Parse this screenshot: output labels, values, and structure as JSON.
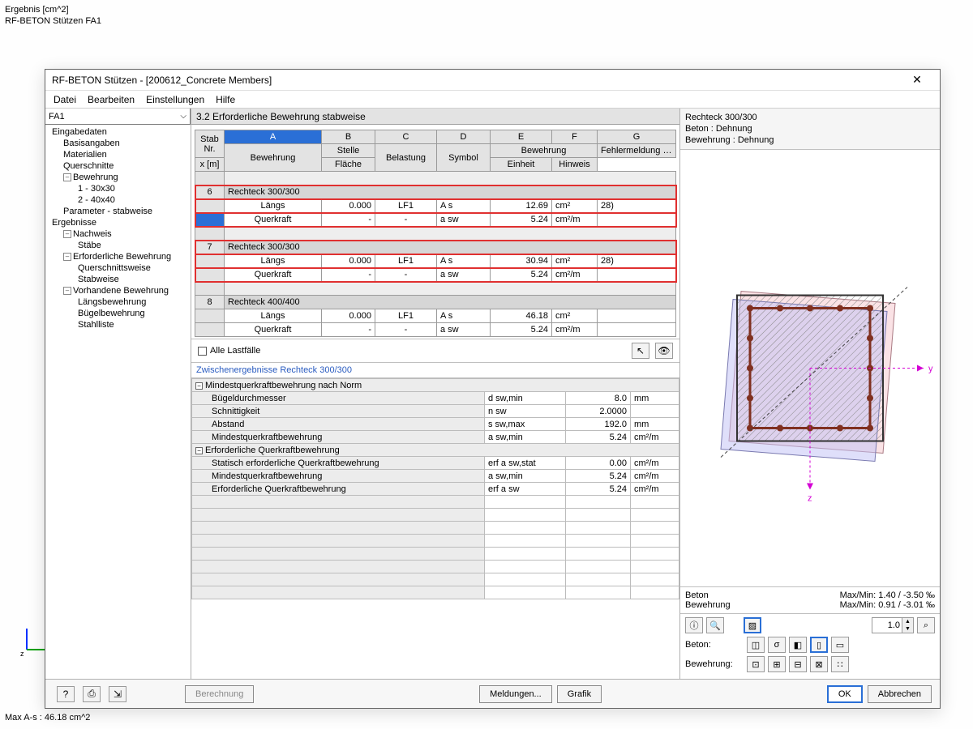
{
  "bg": {
    "l1": "Ergebnis  [cm^2]",
    "l2": "RF-BETON Stützen FA1",
    "bottom": "Max A-s : 46.18 cm^2"
  },
  "window": {
    "title": "RF-BETON Stützen - [200612_Concrete Members]"
  },
  "menu": {
    "datei": "Datei",
    "bearbeiten": "Bearbeiten",
    "einstellungen": "Einstellungen",
    "hilfe": "Hilfe"
  },
  "combo": {
    "value": "FA1"
  },
  "tree": {
    "eingabedaten": "Eingabedaten",
    "basisangaben": "Basisangaben",
    "materialien": "Materialien",
    "querschnitte": "Querschnitte",
    "bewehrung": "Bewehrung",
    "b1": "1 - 30x30",
    "b2": "2 - 40x40",
    "parameter": "Parameter - stabweise",
    "ergebnisse": "Ergebnisse",
    "nachweis": "Nachweis",
    "staebe": "Stäbe",
    "erf": "Erforderliche Bewehrung",
    "querschnittsweise": "Querschnittsweise",
    "stabweise": "Stabweise",
    "vorh": "Vorhandene Bewehrung",
    "laengs": "Längsbewehrung",
    "buegel": "Bügelbewehrung",
    "stahl": "Stahlliste"
  },
  "section": "3.2 Erforderliche Bewehrung stabweise",
  "cols": {
    "letters": {
      "A": "A",
      "B": "B",
      "C": "C",
      "D": "D",
      "E": "E",
      "F": "F",
      "G": "G"
    },
    "stab": "Stab",
    "nr": "Nr.",
    "bewehrung": "Bewehrung",
    "stelle": "Stelle",
    "x": "x [m]",
    "belastung": "Belastung",
    "symbol": "Symbol",
    "bew2": "Bewehrung",
    "flaeche": "Fläche",
    "einheit": "Einheit",
    "fehler": "Fehlermeldung bzw.",
    "hinweis": "Hinweis"
  },
  "groups": [
    {
      "nr": "6",
      "title": "Rechteck 300/300",
      "hl": true,
      "rows": [
        {
          "bew": "Längs",
          "x": "0.000",
          "bel": "LF1",
          "sym": "A s",
          "fla": "12.69",
          "ein": "cm²",
          "hin": "28)"
        },
        {
          "bew": "Querkraft",
          "x": "-",
          "bel": "-",
          "sym": "a sw",
          "fla": "5.24",
          "ein": "cm²/m",
          "hin": "",
          "sel": true
        }
      ]
    },
    {
      "nr": "7",
      "title": "Rechteck 300/300",
      "hl": true,
      "rows": [
        {
          "bew": "Längs",
          "x": "0.000",
          "bel": "LF1",
          "sym": "A s",
          "fla": "30.94",
          "ein": "cm²",
          "hin": "28)"
        },
        {
          "bew": "Querkraft",
          "x": "-",
          "bel": "-",
          "sym": "a sw",
          "fla": "5.24",
          "ein": "cm²/m",
          "hin": ""
        }
      ]
    },
    {
      "nr": "8",
      "title": "Rechteck 400/400",
      "hl": false,
      "rows": [
        {
          "bew": "Längs",
          "x": "0.000",
          "bel": "LF1",
          "sym": "A s",
          "fla": "46.18",
          "ein": "cm²",
          "hin": ""
        },
        {
          "bew": "Querkraft",
          "x": "-",
          "bel": "-",
          "sym": "a sw",
          "fla": "5.24",
          "ein": "cm²/m",
          "hin": ""
        }
      ]
    }
  ],
  "all_lf": "Alle Lastfälle",
  "zres_title": "Zwischenergebnisse Rechteck 300/300",
  "props": [
    {
      "type": "g",
      "label": "Mindestquerkraftbewehrung nach Norm",
      "open": false
    },
    {
      "type": "r",
      "label": "Bügeldurchmesser",
      "sym": "d sw,min",
      "val": "8.0",
      "unit": "mm"
    },
    {
      "type": "r",
      "label": "Schnittigkeit",
      "sym": "n sw",
      "val": "2.0000",
      "unit": ""
    },
    {
      "type": "r",
      "label": "Abstand",
      "sym": "s sw,max",
      "val": "192.0",
      "unit": "mm"
    },
    {
      "type": "r",
      "label": "Mindestquerkraftbewehrung",
      "sym": "a sw,min",
      "val": "5.24",
      "unit": "cm²/m"
    },
    {
      "type": "g",
      "label": "Erforderliche Querkraftbewehrung",
      "open": false
    },
    {
      "type": "r",
      "label": "Statisch erforderliche Querkraftbewehrung",
      "sym": "erf a sw,stat",
      "val": "0.00",
      "unit": "cm²/m"
    },
    {
      "type": "r",
      "label": "Mindestquerkraftbewehrung",
      "sym": "a sw,min",
      "val": "5.24",
      "unit": "cm²/m"
    },
    {
      "type": "r",
      "label": "Erforderliche Querkraftbewehrung",
      "sym": "erf a sw",
      "val": "5.24",
      "unit": "cm²/m"
    }
  ],
  "right": {
    "h1": "Rechteck 300/300",
    "h2": "Beton : Dehnung",
    "h3": "Bewehrung : Dehnung",
    "beton": "Beton",
    "bew": "Bewehrung",
    "mm1": "Max/Min: 1.40 / -3.50 ‰",
    "mm2": "Max/Min: 0.91 / -3.01 ‰",
    "scale": "1.0",
    "lbl_beton": "Beton:",
    "lbl_bew": "Bewehrung:"
  },
  "footer": {
    "berechnung": "Berechnung",
    "meldungen": "Meldungen...",
    "grafik": "Grafik",
    "ok": "OK",
    "abbrechen": "Abbrechen"
  }
}
